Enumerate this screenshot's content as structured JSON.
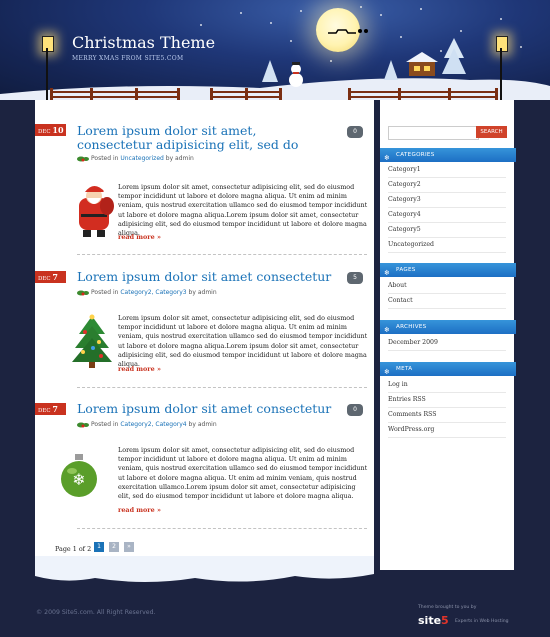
{
  "header": {
    "site_title": "Christmas Theme",
    "site_description": "MERRY XMAS FROM SITE5.COM"
  },
  "posts": [
    {
      "date_month": "DEC",
      "date_day": "10",
      "title": "Lorem ipsum dolor sit amet, consectetur adipisicing elit, sed do",
      "comments": "0",
      "posted_in_label": "Posted in",
      "categories": "Uncategorized",
      "by_label": "by",
      "author": "admin",
      "excerpt": "Lorem ipsum dolor sit amet, consectetur adipisicing elit, sed do eiusmod tempor incididunt ut labore et dolore magna aliqua. Ut enim ad minim veniam, quis nostrud exercitation ullamco sed do eiusmod tempor incididunt ut labore et dolore magna aliqua.Lorem ipsum dolor sit amet, consectetur adipisicing elit, sed do eiusmod tempor incididunt ut labore et dolore magna aliqua.",
      "read_more": "read more »",
      "thumb_icon": "santa-icon"
    },
    {
      "date_month": "DEC",
      "date_day": "7",
      "title": "Lorem ipsum dolor sit amet consectetur",
      "comments": "5",
      "posted_in_label": "Posted in",
      "categories": "Category2, Category3",
      "by_label": "by",
      "author": "admin",
      "excerpt": "Lorem ipsum dolor sit amet, consectetur adipisicing elit, sed do eiusmod tempor incididunt ut labore et dolore magna aliqua. Ut enim ad minim veniam, quis nostrud exercitation ullamco sed do eiusmod tempor incididunt ut labore et dolore magna aliqua.Lorem ipsum dolor sit amet, consectetur adipisicing elit, sed do eiusmod tempor incididunt ut labore et dolore magna aliqua.",
      "read_more": "read more »",
      "thumb_icon": "christmas-tree-icon"
    },
    {
      "date_month": "DEC",
      "date_day": "7",
      "title": "Lorem ipsum dolor sit amet consectetur",
      "comments": "0",
      "posted_in_label": "Posted in",
      "categories": "Category2, Category4",
      "by_label": "by",
      "author": "admin",
      "excerpt": "Lorem ipsum dolor sit amet, consectetur adipisicing elit, sed do eiusmod tempor incididunt ut labore et dolore magna aliqua. Ut enim ad minim veniam, quis nostrud exercitation ullamco sed do eiusmod tempor incididunt ut labore et dolore magna aliqua. Ut enim ad minim veniam, quis nostrud exercitation ullamco.Lorem ipsum dolor sit amet, consectetur adipisicing elit, sed do eiusmod tempor incididunt ut labore et dolore magna aliqua.",
      "read_more": "read more »",
      "thumb_icon": "ornament-icon"
    }
  ],
  "pagination": {
    "label": "Page 1 of 2",
    "pages": [
      "1",
      "2",
      "»"
    ]
  },
  "sidebar": {
    "search": {
      "placeholder": "",
      "button": "SEARCH"
    },
    "categories": {
      "title": "CATEGORIES",
      "items": [
        "Category1",
        "Category2",
        "Category3",
        "Category4",
        "Category5",
        "Uncategorized"
      ]
    },
    "pages": {
      "title": "PAGES",
      "items": [
        "About",
        "Contact"
      ]
    },
    "archives": {
      "title": "ARCHIVES",
      "items": [
        "December 2009"
      ]
    },
    "meta": {
      "title": "META",
      "items": [
        "Log in",
        "Entries RSS",
        "Comments RSS",
        "WordPress.org"
      ]
    }
  },
  "footer": {
    "copyright": "© 2009 Site5.com. All Right Reserved.",
    "brought_by": "Theme brought to you by",
    "logo_text": "site",
    "logo_number": "5",
    "tagline": "Experts in Web Hosting"
  },
  "colors": {
    "accent_blue": "#1a72b7",
    "accent_red": "#c9321f",
    "night_sky": "#152554",
    "page_background": "#1c2340"
  }
}
